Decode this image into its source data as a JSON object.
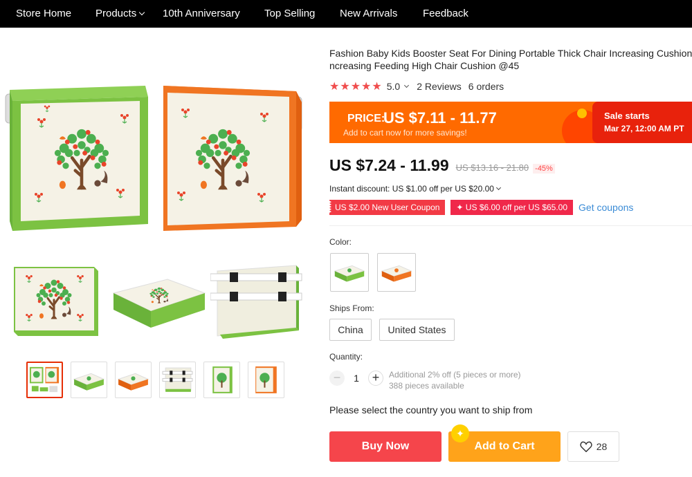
{
  "nav": {
    "items": [
      "Store Home",
      "Products",
      "10th Anniversary",
      "Top Selling",
      "New Arrivals",
      "Feedback"
    ]
  },
  "product": {
    "title_line1": "Fashion Baby Kids Booster Seat For Dining Portable Thick Chair Increasing Cushion",
    "title_line2": "ncreasing Feeding High Chair Cushion @45",
    "rating_value": "5.0",
    "reviews": "2 Reviews",
    "orders": "6 orders",
    "stars": "★★★★★"
  },
  "promo": {
    "price_label": "PRICE:",
    "price_value": "US $7.11 - 11.77",
    "subtext": "Add to cart now for more savings!",
    "sale_title": "Sale starts",
    "sale_date": "Mar 27, 12:00 AM PT"
  },
  "price": {
    "current": "US $7.24 - 11.99",
    "original": "US $13.16 - 21.80",
    "discount": "-45%"
  },
  "instant_discount": "Instant discount: US $1.00 off per US $20.00",
  "coupons": {
    "new_user": "US $2.00 New User Coupon",
    "store": "✦ US $6.00 off per US $65.00",
    "get": "Get coupons"
  },
  "options": {
    "color_label": "Color:",
    "ships_from_label": "Ships From:",
    "ship_options": [
      "China",
      "United States"
    ],
    "quantity_label": "Quantity:",
    "quantity_value": "1",
    "qty_minus": "−",
    "qty_plus": "+",
    "qty_note1": "Additional 2% off (5 pieces or more)",
    "qty_note2": "388 pieces available"
  },
  "ship_message": "Please select the country you want to ship from",
  "actions": {
    "buy_now": "Buy Now",
    "add_to_cart": "Add to Cart",
    "wishlist_count": "28"
  },
  "colors": {
    "nav_bg": "#000000",
    "promo_orange": "#ff6a00",
    "sale_red": "#e8220c",
    "buy_red": "#f5454b",
    "cart_orange": "#ffa31a",
    "cushion_green": "#7cc242",
    "cushion_orange": "#f07522",
    "link_blue": "#3a8bd6"
  }
}
